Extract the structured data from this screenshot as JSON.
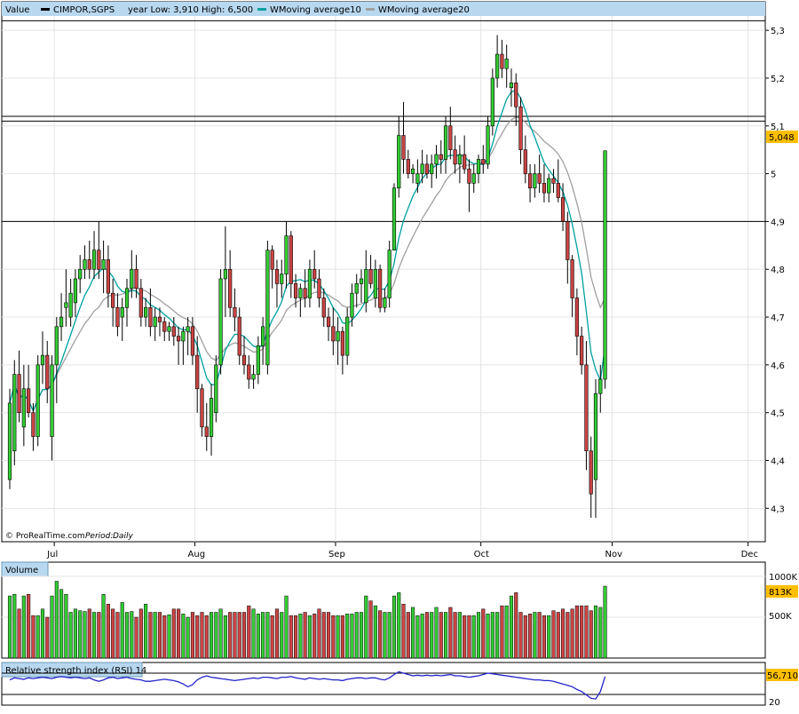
{
  "header": {
    "value_label": "Value",
    "symbol": "CIMPOR,SGPS",
    "range_text": "year Low: 3,910 High: 6,500",
    "ma10_label": "WMoving average10",
    "ma20_label": "WMoving average20"
  },
  "colors": {
    "up": "#33cc33",
    "down": "#cc4444",
    "ma10": "#00a0a0",
    "ma20": "#a0a0a0",
    "rsi": "#2222cc",
    "panel_title_bg": "#b8d8f0",
    "badge_bg": "#ffbf00"
  },
  "footer": {
    "copyright": "© ProRealTime.com",
    "period_label": "Period:",
    "period_value": "Daily"
  },
  "price_badge": "5,048",
  "volume_panel": {
    "title": "Volume",
    "ticks": [
      "1000K",
      "500K"
    ],
    "badge": "813K"
  },
  "rsi_panel": {
    "title": "Relative strength index (RSI) 14",
    "badge": "56,7107",
    "tick_low": "20"
  },
  "chart_data": {
    "type": "candlestick",
    "y_axis_ticks": [
      "5,3",
      "5,2",
      "5,1",
      "5",
      "4,9",
      "4,8",
      "4,7",
      "4,6",
      "4,5",
      "4,4",
      "4,3"
    ],
    "ylim": [
      4.23,
      5.33
    ],
    "x_axis_months": [
      "Jul",
      "Aug",
      "Sep",
      "Oct",
      "Nov",
      "Dec"
    ],
    "month_start_index": [
      10,
      40,
      70,
      101,
      129,
      158
    ],
    "horizontal_levels": [
      5.32,
      5.12,
      5.11,
      4.9
    ],
    "candles": [
      [
        4.36,
        4.55,
        4.34,
        4.52
      ],
      [
        4.42,
        4.61,
        4.39,
        4.58
      ],
      [
        4.58,
        4.63,
        4.48,
        4.5
      ],
      [
        4.47,
        4.6,
        4.43,
        4.55
      ],
      [
        4.55,
        4.6,
        4.49,
        4.5
      ],
      [
        4.5,
        4.52,
        4.42,
        4.45
      ],
      [
        4.45,
        4.62,
        4.43,
        4.6
      ],
      [
        4.6,
        4.67,
        4.56,
        4.62
      ],
      [
        4.62,
        4.65,
        4.52,
        4.55
      ],
      [
        4.45,
        4.62,
        4.4,
        4.6
      ],
      [
        4.6,
        4.7,
        4.52,
        4.68
      ],
      [
        4.68,
        4.75,
        4.65,
        4.7
      ],
      [
        4.72,
        4.8,
        4.68,
        4.73
      ],
      [
        4.7,
        4.78,
        4.68,
        4.75
      ],
      [
        4.73,
        4.8,
        4.7,
        4.78
      ],
      [
        4.78,
        4.83,
        4.75,
        4.8
      ],
      [
        4.8,
        4.85,
        4.78,
        4.82
      ],
      [
        4.82,
        4.86,
        4.78,
        4.8
      ],
      [
        4.8,
        4.88,
        4.78,
        4.84
      ],
      [
        4.84,
        4.9,
        4.78,
        4.8
      ],
      [
        4.8,
        4.86,
        4.75,
        4.82
      ],
      [
        4.82,
        4.85,
        4.72,
        4.75
      ],
      [
        4.75,
        4.78,
        4.68,
        4.72
      ],
      [
        4.72,
        4.75,
        4.66,
        4.68
      ],
      [
        4.7,
        4.74,
        4.65,
        4.72
      ],
      [
        4.72,
        4.78,
        4.68,
        4.76
      ],
      [
        4.76,
        4.84,
        4.74,
        4.8
      ],
      [
        4.8,
        4.83,
        4.74,
        4.76
      ],
      [
        4.76,
        4.78,
        4.68,
        4.7
      ],
      [
        4.7,
        4.74,
        4.68,
        4.72
      ],
      [
        4.72,
        4.76,
        4.66,
        4.68
      ],
      [
        4.68,
        4.72,
        4.65,
        4.7
      ],
      [
        4.7,
        4.72,
        4.66,
        4.69
      ],
      [
        4.69,
        4.7,
        4.65,
        4.67
      ],
      [
        4.67,
        4.69,
        4.65,
        4.68
      ],
      [
        4.68,
        4.7,
        4.64,
        4.66
      ],
      [
        4.66,
        4.68,
        4.6,
        4.65
      ],
      [
        4.65,
        4.68,
        4.6,
        4.67
      ],
      [
        4.67,
        4.7,
        4.62,
        4.68
      ],
      [
        4.68,
        4.7,
        4.6,
        4.62
      ],
      [
        4.62,
        4.66,
        4.5,
        4.55
      ],
      [
        4.55,
        4.56,
        4.45,
        4.47
      ],
      [
        4.47,
        4.52,
        4.42,
        4.45
      ],
      [
        4.45,
        4.56,
        4.41,
        4.53
      ],
      [
        4.5,
        4.62,
        4.48,
        4.6
      ],
      [
        4.6,
        4.8,
        4.58,
        4.78
      ],
      [
        4.78,
        4.89,
        4.7,
        4.8
      ],
      [
        4.8,
        4.84,
        4.7,
        4.72
      ],
      [
        4.72,
        4.76,
        4.67,
        4.7
      ],
      [
        4.7,
        4.72,
        4.6,
        4.62
      ],
      [
        4.62,
        4.66,
        4.58,
        4.6
      ],
      [
        4.6,
        4.62,
        4.55,
        4.57
      ],
      [
        4.57,
        4.6,
        4.55,
        4.58
      ],
      [
        4.58,
        4.66,
        4.56,
        4.64
      ],
      [
        4.64,
        4.7,
        4.6,
        4.68
      ],
      [
        4.6,
        4.86,
        4.58,
        4.84
      ],
      [
        4.84,
        4.85,
        4.76,
        4.8
      ],
      [
        4.8,
        4.82,
        4.72,
        4.77
      ],
      [
        4.77,
        4.82,
        4.74,
        4.79
      ],
      [
        4.79,
        4.9,
        4.76,
        4.87
      ],
      [
        4.87,
        4.88,
        4.74,
        4.77
      ],
      [
        4.77,
        4.79,
        4.72,
        4.74
      ],
      [
        4.74,
        4.77,
        4.7,
        4.76
      ],
      [
        4.76,
        4.8,
        4.72,
        4.74
      ],
      [
        4.74,
        4.82,
        4.72,
        4.8
      ],
      [
        4.8,
        4.84,
        4.76,
        4.78
      ],
      [
        4.78,
        4.8,
        4.72,
        4.74
      ],
      [
        4.74,
        4.76,
        4.68,
        4.7
      ],
      [
        4.7,
        4.72,
        4.65,
        4.68
      ],
      [
        4.68,
        4.72,
        4.62,
        4.65
      ],
      [
        4.65,
        4.7,
        4.6,
        4.67
      ],
      [
        4.67,
        4.68,
        4.58,
        4.62
      ],
      [
        4.62,
        4.72,
        4.6,
        4.7
      ],
      [
        4.7,
        4.77,
        4.68,
        4.75
      ],
      [
        4.75,
        4.79,
        4.72,
        4.77
      ],
      [
        4.77,
        4.8,
        4.73,
        4.78
      ],
      [
        4.73,
        4.84,
        4.71,
        4.8
      ],
      [
        4.8,
        4.83,
        4.76,
        4.77
      ],
      [
        4.74,
        4.82,
        4.72,
        4.8
      ],
      [
        4.8,
        4.81,
        4.71,
        4.72
      ],
      [
        4.72,
        4.76,
        4.71,
        4.74
      ],
      [
        4.74,
        4.86,
        4.72,
        4.84
      ],
      [
        4.84,
        4.98,
        4.84,
        4.97
      ],
      [
        4.97,
        5.12,
        4.95,
        5.08
      ],
      [
        5.08,
        5.15,
        5.0,
        5.03
      ],
      [
        5.03,
        5.05,
        4.99,
        5.0
      ],
      [
        5.0,
        5.02,
        4.98,
        5.01
      ],
      [
        4.98,
        5.03,
        4.96,
        5.0
      ],
      [
        5.0,
        5.05,
        4.98,
        5.02
      ],
      [
        5.02,
        5.04,
        4.99,
        5.0
      ],
      [
        5.0,
        5.04,
        4.97,
        5.02
      ],
      [
        5.02,
        5.06,
        4.99,
        5.04
      ],
      [
        5.04,
        5.07,
        5.0,
        5.03
      ],
      [
        5.03,
        5.12,
        5.0,
        5.1
      ],
      [
        5.1,
        5.14,
        5.03,
        5.05
      ],
      [
        5.05,
        5.08,
        5.0,
        5.02
      ],
      [
        5.02,
        5.06,
        4.98,
        5.04
      ],
      [
        5.04,
        5.08,
        5.0,
        5.01
      ],
      [
        5.01,
        5.03,
        4.92,
        4.98
      ],
      [
        4.98,
        5.02,
        4.96,
        5.0
      ],
      [
        5.0,
        5.04,
        4.98,
        5.03
      ],
      [
        5.03,
        5.06,
        5.0,
        5.02
      ],
      [
        5.02,
        5.12,
        5.01,
        5.1
      ],
      [
        5.1,
        5.22,
        5.08,
        5.2
      ],
      [
        5.2,
        5.29,
        5.18,
        5.25
      ],
      [
        5.25,
        5.28,
        5.2,
        5.22
      ],
      [
        5.22,
        5.27,
        5.18,
        5.24
      ],
      [
        5.18,
        5.22,
        5.14,
        5.19
      ],
      [
        5.19,
        5.21,
        5.1,
        5.14
      ],
      [
        5.14,
        5.16,
        5.02,
        5.05
      ],
      [
        5.05,
        5.08,
        4.98,
        5.0
      ],
      [
        5.0,
        5.02,
        4.94,
        4.97
      ],
      [
        4.97,
        5.02,
        4.95,
        5.0
      ],
      [
        5.0,
        5.04,
        4.96,
        4.98
      ],
      [
        4.98,
        5.02,
        4.94,
        4.96
      ],
      [
        4.96,
        5.0,
        4.94,
        4.99
      ],
      [
        4.99,
        5.01,
        4.96,
        4.98
      ],
      [
        4.98,
        5.03,
        4.94,
        4.95
      ],
      [
        4.95,
        4.98,
        4.88,
        4.9
      ],
      [
        4.9,
        4.92,
        4.77,
        4.82
      ],
      [
        4.82,
        4.83,
        4.7,
        4.74
      ],
      [
        4.74,
        4.76,
        4.62,
        4.66
      ],
      [
        4.66,
        4.68,
        4.58,
        4.6
      ],
      [
        4.6,
        4.65,
        4.38,
        4.42
      ],
      [
        4.42,
        4.45,
        4.28,
        4.33
      ],
      [
        4.36,
        4.57,
        4.28,
        4.54
      ],
      [
        4.54,
        4.6,
        4.5,
        4.57
      ],
      [
        4.57,
        5.02,
        4.55,
        5.048
      ]
    ],
    "volume": [
      760,
      780,
      600,
      760,
      780,
      520,
      520,
      600,
      500,
      760,
      940,
      840,
      780,
      560,
      600,
      580,
      570,
      600,
      560,
      560,
      780,
      660,
      600,
      560,
      680,
      560,
      570,
      500,
      600,
      660,
      560,
      560,
      560,
      520,
      530,
      600,
      600,
      540,
      500,
      560,
      520,
      560,
      520,
      560,
      560,
      600,
      520,
      560,
      560,
      560,
      560,
      640,
      600,
      540,
      560,
      560,
      520,
      600,
      560,
      760,
      520,
      520,
      540,
      560,
      520,
      540,
      600,
      560,
      560,
      520,
      520,
      520,
      540,
      540,
      560,
      560,
      760,
      700,
      640,
      580,
      560,
      560,
      760,
      800,
      660,
      560,
      620,
      520,
      540,
      560,
      560,
      620,
      560,
      560,
      620,
      560,
      560,
      520,
      520,
      520,
      560,
      600,
      540,
      560,
      560,
      640,
      640,
      760,
      800,
      560,
      520,
      540,
      560,
      560,
      520,
      520,
      580,
      560,
      600,
      560,
      600,
      640,
      640,
      640,
      580,
      640,
      620,
      880
    ],
    "volume_max": 1000,
    "rsi": [
      52,
      55,
      54,
      53,
      55,
      54,
      55,
      56,
      55,
      54,
      56,
      57,
      56,
      55,
      56,
      55,
      54,
      55,
      52,
      50,
      52,
      55,
      56,
      54,
      55,
      56,
      54,
      53,
      52,
      50,
      50,
      51,
      52,
      53,
      52,
      51,
      49,
      46,
      42,
      45,
      52,
      56,
      58,
      56,
      55,
      54,
      53,
      52,
      51,
      52,
      53,
      54,
      55,
      54,
      56,
      56,
      55,
      54,
      56,
      56,
      57,
      55,
      54,
      53,
      55,
      54,
      53,
      54,
      53,
      52,
      52,
      51,
      53,
      54,
      55,
      55,
      54,
      55,
      55,
      53,
      52,
      55,
      60,
      64,
      62,
      60,
      58,
      59,
      58,
      59,
      58,
      59,
      58,
      59,
      60,
      58,
      58,
      57,
      56,
      57,
      58,
      60,
      62,
      61,
      60,
      59,
      58,
      57,
      56,
      55,
      54,
      53,
      52,
      52,
      51,
      51,
      50,
      48,
      46,
      44,
      42,
      38,
      35,
      30,
      25,
      24,
      35,
      57
    ]
  }
}
